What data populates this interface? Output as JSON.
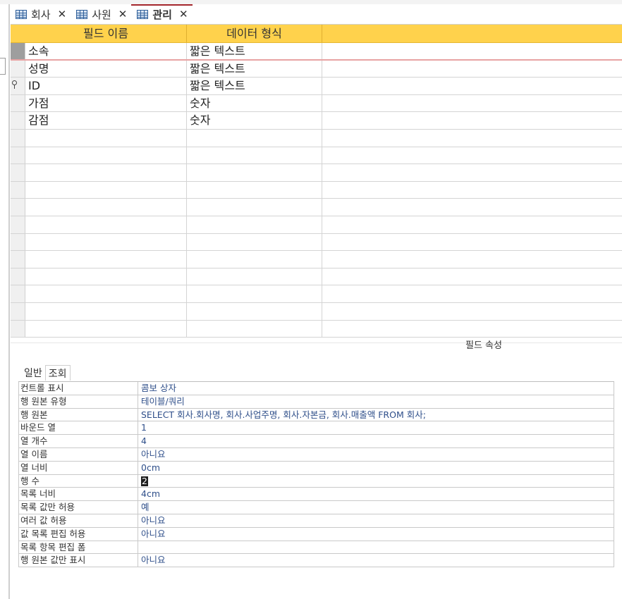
{
  "tabs": [
    {
      "label": "회사",
      "close": "✕"
    },
    {
      "label": "사원",
      "close": "✕"
    },
    {
      "label": "관리",
      "close": "✕"
    }
  ],
  "design": {
    "col_field_name": "필드 이름",
    "col_data_type": "데이터 형식",
    "rows": [
      {
        "field": "소속",
        "type": "짧은 텍스트"
      },
      {
        "field": "성명",
        "type": "짧은 텍스트"
      },
      {
        "field": "ID",
        "type": "짧은 텍스트"
      },
      {
        "field": "가점",
        "type": "숫자"
      },
      {
        "field": "감점",
        "type": "숫자"
      }
    ],
    "empty_rows": 12
  },
  "properties": {
    "title": "필드 속성",
    "tab_general": "일반",
    "tab_lookup": "조회",
    "rows": [
      {
        "label": "컨트롤 표시",
        "value": "콤보 상자"
      },
      {
        "label": "행 원본 유형",
        "value": "테이블/쿼리"
      },
      {
        "label": "행 원본",
        "value": "SELECT 회사.회사명, 회사.사업주명, 회사.자본금, 회사.매출액 FROM 회사;"
      },
      {
        "label": "바운드 열",
        "value": "1"
      },
      {
        "label": "열 개수",
        "value": "4"
      },
      {
        "label": "열 이름",
        "value": "아니요"
      },
      {
        "label": "열 너비",
        "value": "0cm"
      },
      {
        "label": "행 수",
        "value": "2"
      },
      {
        "label": "목록 너비",
        "value": "4cm"
      },
      {
        "label": "목록 값만 허용",
        "value": "예"
      },
      {
        "label": "여러 값 허용",
        "value": "아니요"
      },
      {
        "label": "값 목록 편집 허용",
        "value": "아니요"
      },
      {
        "label": "목록 항목 편집 폼",
        "value": ""
      },
      {
        "label": "행 원본 값만 표시",
        "value": "아니요"
      }
    ]
  }
}
